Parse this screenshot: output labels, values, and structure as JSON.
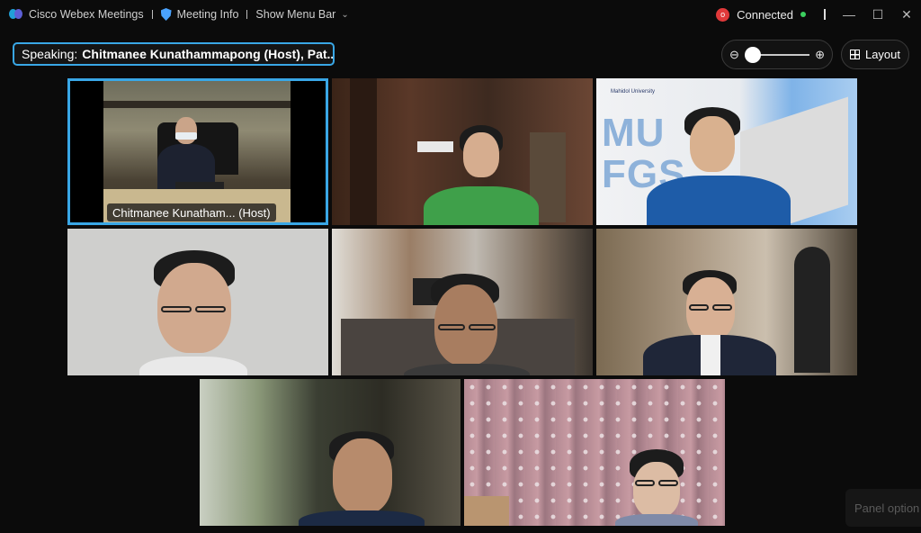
{
  "titlebar": {
    "app_name": "Cisco Webex Meetings",
    "meeting_info": "Meeting Info",
    "show_menu_bar": "Show Menu Bar",
    "status": "Connected",
    "status_color": "#3bcf5e",
    "record_icon_color": "#e0393a"
  },
  "speaking": {
    "prefix": "Speaking:",
    "names": "Chitmanee Kunathammapong (Host), Pat..."
  },
  "controls": {
    "zoom_out_icon": "zoom-out-icon",
    "zoom_in_icon": "zoom-in-icon",
    "zoom_level": 0.0,
    "layout_label": "Layout"
  },
  "video_tiles": [
    {
      "label": "Chitmanee Kunatham... (Host)",
      "active": true,
      "accent": "#39a7e6"
    },
    {
      "label": ""
    },
    {
      "label": ""
    },
    {
      "label": ""
    },
    {
      "label": ""
    },
    {
      "label": ""
    },
    {
      "label": ""
    },
    {
      "label": ""
    }
  ],
  "tile3_banner": {
    "org": "Mahidol University",
    "letters1": "MU",
    "letters2": "FGS"
  },
  "panel_options": "Panel option"
}
